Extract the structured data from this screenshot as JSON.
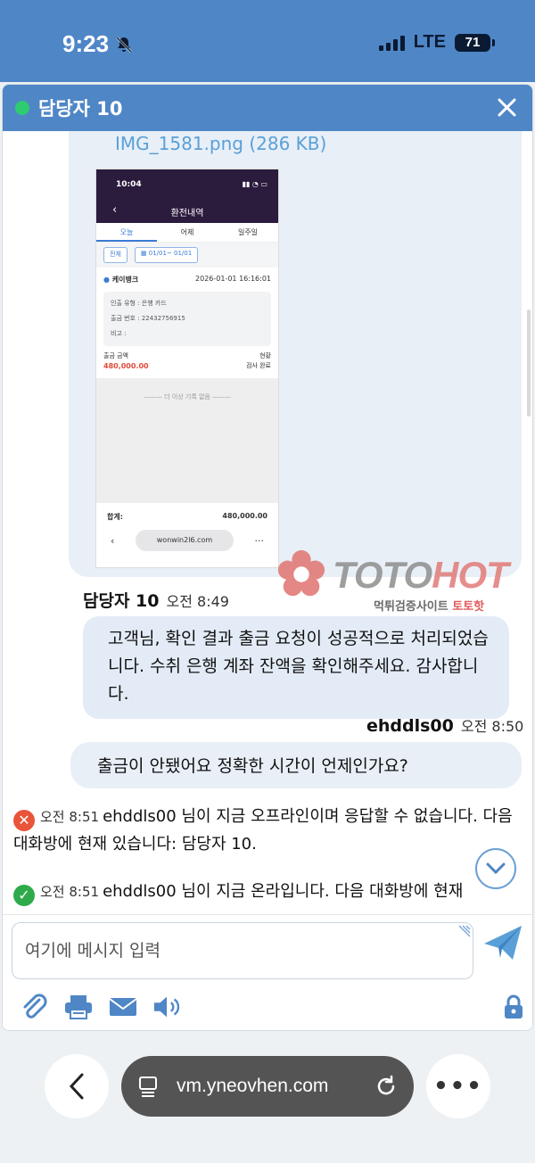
{
  "status_bar": {
    "time": "9:23",
    "network": "LTE",
    "battery": "71"
  },
  "chat": {
    "title": "담당자 10"
  },
  "attachment": {
    "filename": "IMG_1581.png (286 KB)",
    "screenshot": {
      "time": "10:04",
      "title": "환전내역",
      "tabs": [
        "오늘",
        "어제",
        "일주일"
      ],
      "filter_all": "전체",
      "date_range": "01/01~ 01/01",
      "bank": "케이뱅크",
      "datetime": "2026-01-01 16:16:01",
      "withdraw_type": "인출 유형 : 은행 카드",
      "withdraw_no": "출금 번호 : 22432756915",
      "note": "비고 :",
      "amount_label": "출금 금액",
      "amount": "480,000.00",
      "status_label": "현황",
      "status": "검사 완료",
      "no_more": "더 이상 기록 없음",
      "total_label": "합계:",
      "total": "480,000.00",
      "url": "wonwin2l6.com"
    }
  },
  "watermark": {
    "toto": "TOTO",
    "hot": "HOT",
    "sub": "먹튀검증사이트",
    "sub_red": "토토핫"
  },
  "messages": [
    {
      "sender": "담당자 10",
      "time": "오전 8:49",
      "text": "고객님, 확인 결과 출금 요청이 성공적으로 처리되었습니다. 수취 은행 계좌 잔액을 확인해주세요. 감사합니다."
    },
    {
      "sender": "ehddls00",
      "time": "오전 8:50",
      "text": "출금이 안됐어요 정확한 시간이 언제인가요?"
    }
  ],
  "system": [
    {
      "time": "오전 8:51",
      "text": "ehddls00 님이 지금 오프라인이며 응답할 수 없습니다. 다음 대화방에 현재 있습니다: 담당자 10.",
      "status": "offline",
      "color": "#e8553a"
    },
    {
      "time": "오전 8:51",
      "text": "ehddls00 님이 지금 온라입니다. 다음 대화방에 현재",
      "status": "online",
      "color": "#2eaa4a"
    }
  ],
  "input": {
    "placeholder": "여기에 메시지 입력"
  },
  "browser": {
    "url": "vm.yneovhen.com"
  },
  "colors": {
    "header": "#4f86c6",
    "bubble": "#e3ecf6",
    "accent": "#5aa0d8"
  }
}
